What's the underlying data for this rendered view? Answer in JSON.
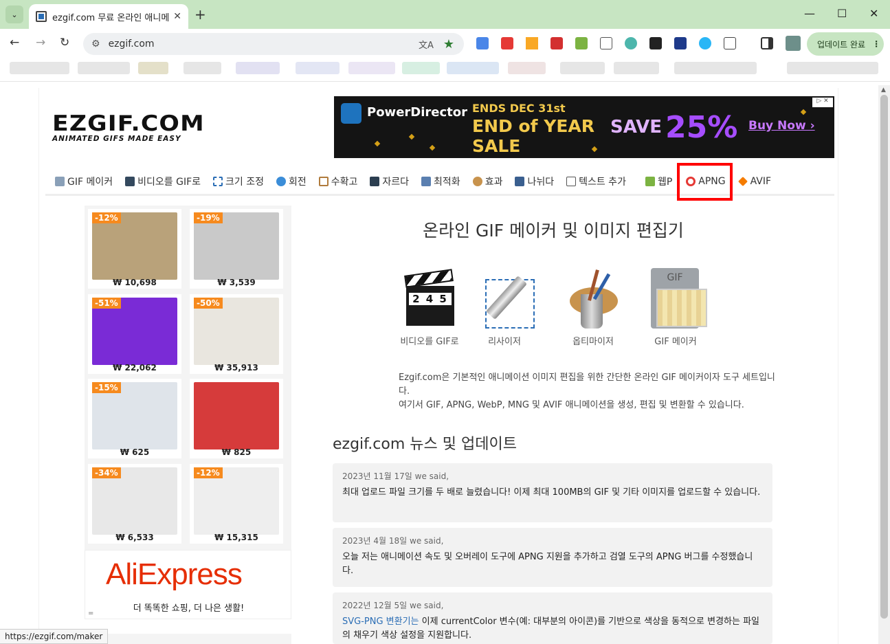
{
  "browser": {
    "tab_title": "ezgif.com 무료 온라인 애니메이",
    "url": "ezgif.com",
    "update_button": "업데이트 완료",
    "status_url": "https://ezgif.com/maker"
  },
  "site": {
    "logo_main": "EZGIF.COM",
    "logo_tagline": "ANIMATED GIFS MADE EASY",
    "menu": [
      "GIF 메이커",
      "비디오를 GIF로",
      "크기 조정",
      "회전",
      "수확고",
      "자르다",
      "최적화",
      "효과",
      "나뉘다",
      "텍스트 추가",
      "웹P",
      "APNG",
      "AVIF"
    ]
  },
  "ad": {
    "brand": "PowerDirector",
    "ends": "ENDS DEC 31st",
    "line1": "END of YEAR",
    "line2": "SALE",
    "save": "SAVE",
    "percent": "25%",
    "cta": "Buy Now ›"
  },
  "products": [
    {
      "discount": "-12%",
      "price": "₩ 10,698",
      "color": "#b9a27a"
    },
    {
      "discount": "-19%",
      "price": "₩ 3,539",
      "color": "#c9c9c9"
    },
    {
      "discount": "-51%",
      "price": "₩ 22,062",
      "color": "#7a2bd6"
    },
    {
      "discount": "-50%",
      "price": "₩ 35,913",
      "color": "#e9e6df"
    },
    {
      "discount": "-15%",
      "price": "₩ 625",
      "color": "#dfe4ea"
    },
    {
      "discount": "",
      "price": "₩ 825",
      "color": "#d63b3b"
    },
    {
      "discount": "-34%",
      "price": "₩ 6,533",
      "color": "#e8e8e8"
    },
    {
      "discount": "-12%",
      "price": "₩ 15,315",
      "color": "#eeeeee"
    }
  ],
  "aliexpress": {
    "brand": "AliExpress",
    "tagline": "더 똑똑한 쇼핑, 더 나은 생활!",
    "mark": "="
  },
  "main": {
    "title": "온라인 GIF 메이커 및 이미지 편집기",
    "tools": [
      "비디오를 GIF로",
      "리사이저",
      "옵티마이저",
      "GIF 메이커"
    ],
    "clapper_digits": "2 4 5",
    "gif_label": "GIF",
    "intro_line1": "Ezgif.com은 기본적인 애니메이션 이미지 편집을 위한 간단한 온라인 GIF 메이커이자 도구 세트입니다.",
    "intro_line2": "여기서 GIF, APNG, WebP, MNG 및 AVIF 애니메이션을 생성, 편집 및 변환할 수 있습니다.",
    "news_title": "ezgif.com 뉴스 및 업데이트",
    "news": [
      {
        "date": "2023년 11월 17일",
        "said": "we said,",
        "body": "최대 업로드 파일 크기를 두 배로 늘렸습니다! 이제 최대 100MB의 GIF 및 기타 이미지를 업로드할 수 있습니다."
      },
      {
        "date": "2023년 4월 18일",
        "said": "we said,",
        "body": "오늘 저는 애니메이션 속도 및 오버레이 도구에 APNG 지원을 추가하고 검열 도구의 APNG 버그를 수정했습니다."
      },
      {
        "date": "2022년 12월 5일",
        "said": "we said,",
        "link": "SVG-PNG 변환기는",
        "body": " 이제 currentColor 변수(예: 대부분의 아이콘)를 기반으로 색상을 동적으로 변경하는 파일의 채우기 색상 설정을 지원합니다."
      }
    ]
  }
}
